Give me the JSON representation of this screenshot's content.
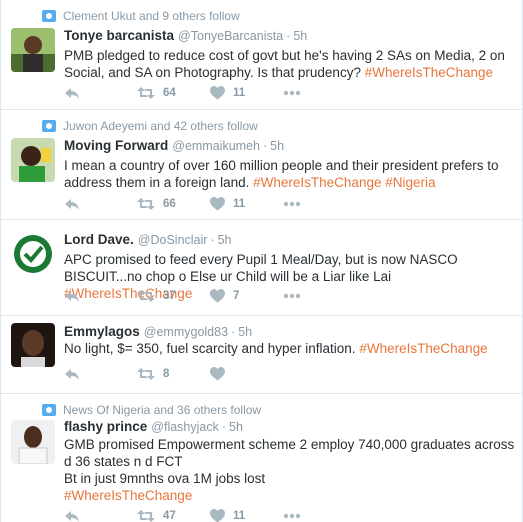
{
  "tweets": [
    {
      "context": "Clement Ukut and 9 others follow",
      "fullname": "Tonye barcanista",
      "handle": "@TonyeBarcanista",
      "sep": "·",
      "time": "5h",
      "text": "PMB pledged to reduce cost of govt but he's having 2 SAs on Media, 2 on Social, and SA on Photography. Is that prudency?",
      "tags": "#WhereIsTheChange",
      "retweets": "64",
      "likes": "11"
    },
    {
      "context": "Juwon Adeyemi and 42 others follow",
      "fullname": "Moving Forward",
      "handle": "@emmaikumeh",
      "sep": "·",
      "time": "5h",
      "text": "I mean a country of over 160 million people and their president prefers to address them in a foreign land.",
      "tags": "#WhereIsTheChange #Nigeria",
      "retweets": "66",
      "likes": "11"
    },
    {
      "context": "",
      "fullname": "Lord Dave.",
      "handle": "@DoSinclair",
      "sep": "·",
      "time": "5h",
      "text": "APC promised to feed every Pupil 1 Meal/Day, but is now NASCO BISCUIT...no chop o Else ur Child will be a Liar like Lai",
      "tags": "#WhereIsTheChange",
      "retweets": "37",
      "likes": "7"
    },
    {
      "context": "",
      "fullname": "Emmylagos",
      "handle": "@emmygold83",
      "sep": "·",
      "time": "5h",
      "text": "No light, $= 350, fuel scarcity and hyper inflation.",
      "tags": "#WhereIsTheChange",
      "retweets": "8",
      "likes": ""
    },
    {
      "context": "News Of Nigeria and 36 others follow",
      "fullname": "flashy prince",
      "handle": "@flashyjack",
      "sep": "·",
      "time": "5h",
      "text": "GMB promised Empowerment scheme 2 employ 740,000 graduates across d 36 states n d FCT\nBt in just 9mnths ova 1M jobs lost",
      "tags": "#WhereIsTheChange",
      "retweets": "47",
      "likes": "11"
    }
  ]
}
